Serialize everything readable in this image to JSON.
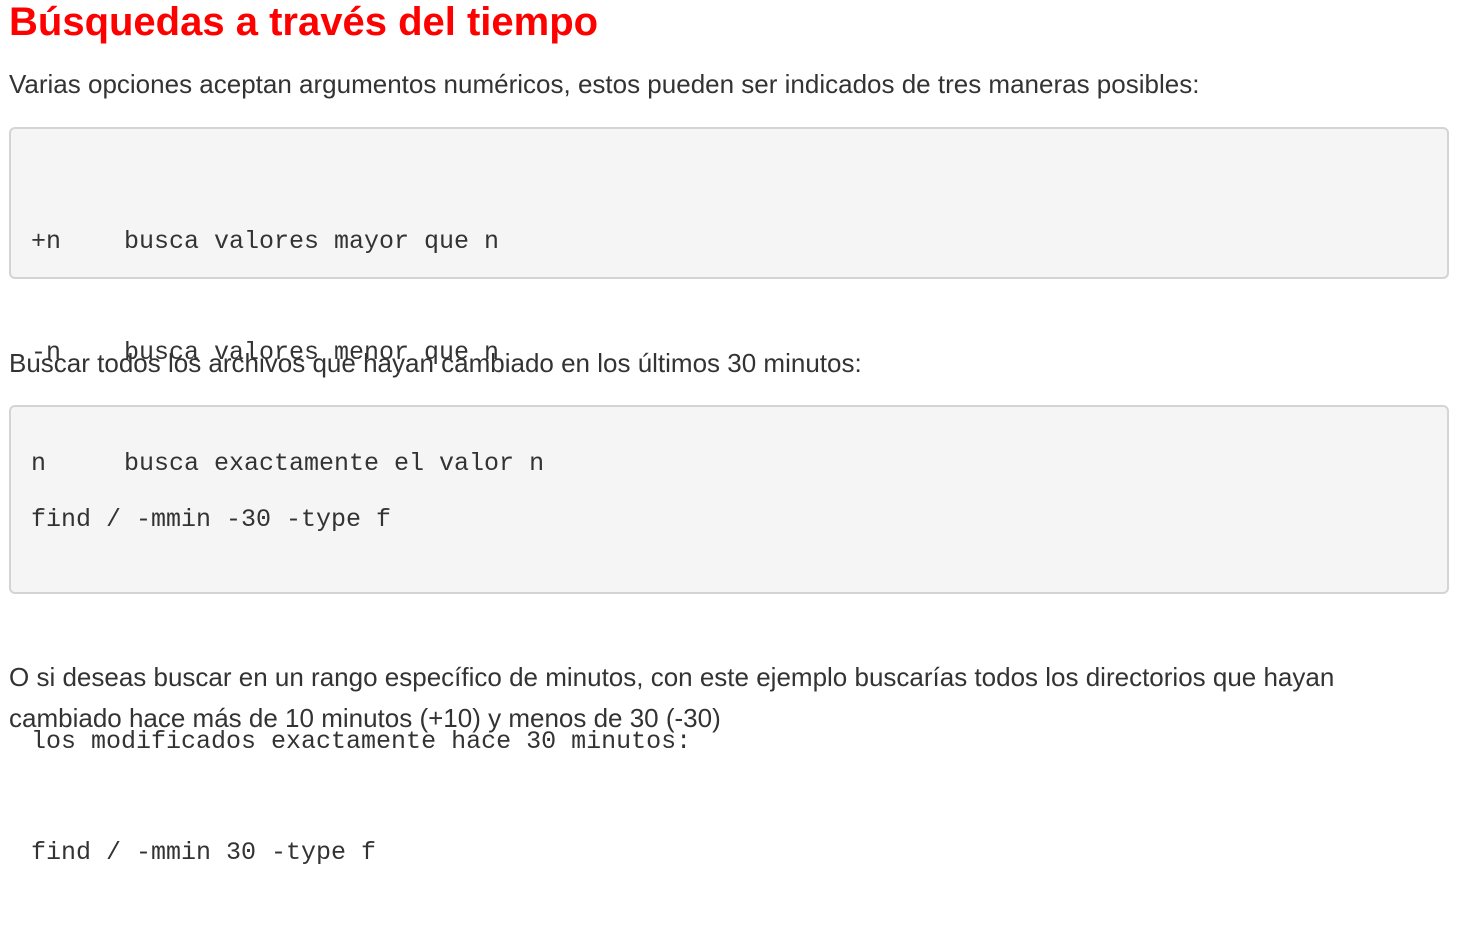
{
  "heading": "Búsquedas a través del tiempo",
  "intro": "Varias opciones aceptan argumentos numéricos, estos pueden ser indicados de tres maneras posibles:",
  "options": [
    {
      "flag": "+n",
      "desc": "busca valores mayor que n"
    },
    {
      "flag": "-n",
      "desc": "busca valores menor que n"
    },
    {
      "flag": "n",
      "desc": "busca exactamente el valor n"
    }
  ],
  "search_text": "Buscar todos los archivos que hayan cambiado en los últimos 30 minutos:",
  "code2": {
    "line1": "find / -mmin -30 -type f",
    "line2": "",
    "line3": "los modificados exactamente hace 30 minutos:",
    "line4": "find / -mmin 30 -type f"
  },
  "range_text": "O si deseas buscar en un rango específico de minutos, con este ejemplo buscarías todos los directorios que hayan cambiado hace más de 10 minutos (+10) y menos de 30 (-30)"
}
